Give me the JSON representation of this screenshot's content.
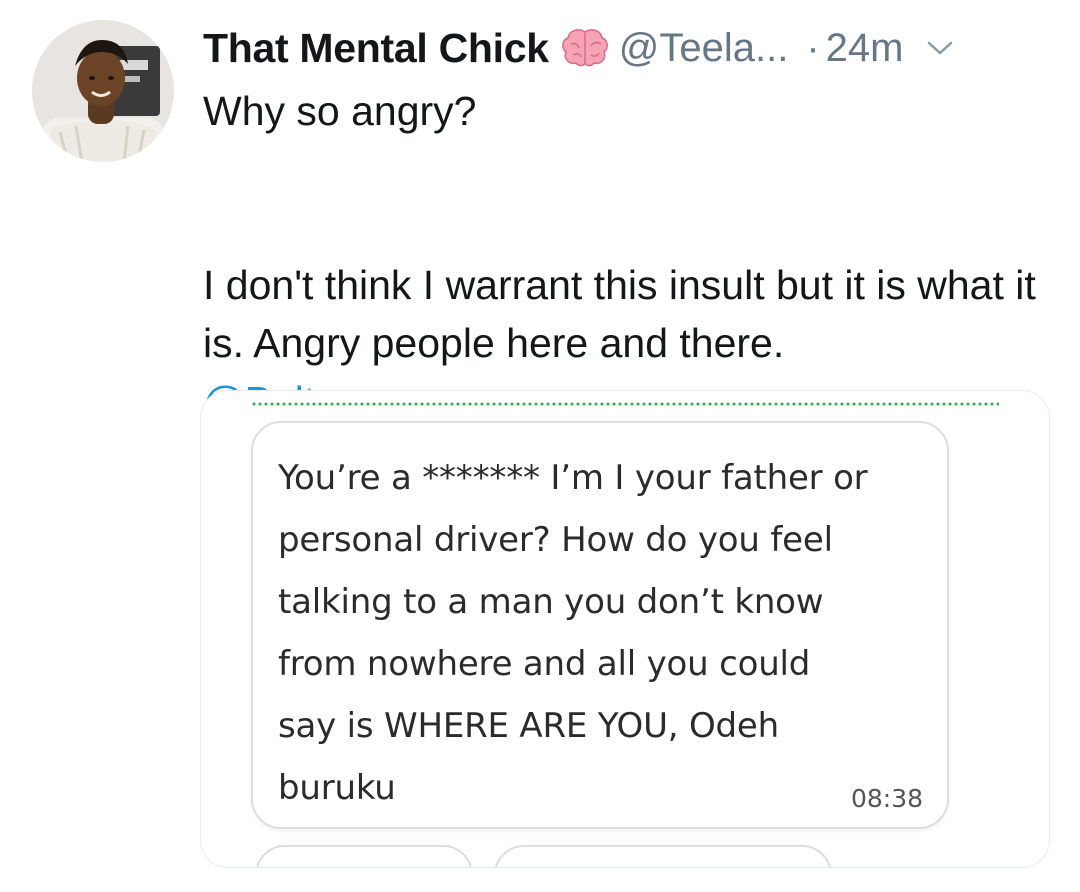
{
  "tweet": {
    "author": {
      "display_name": "That Mental Chick",
      "name_emoji": "brain-icon",
      "handle": "@Teela...",
      "separator": "·",
      "time": "24m"
    },
    "text": {
      "line1": "Why so angry?",
      "line2": "I don't think I warrant this insult but it is what it is. Angry people here and there.",
      "mention": "@Boltapp_ng"
    },
    "media": {
      "message_lines": [
        "You’re a ******* I’m I your father or",
        "personal driver? How do you feel",
        "talking to a man you don’t know",
        "from nowhere and all you could",
        "say is WHERE ARE YOU, Odeh",
        "buruku"
      ],
      "message_time": "08:38"
    }
  },
  "colors": {
    "text_primary": "#14171a",
    "text_secondary": "#657786",
    "link": "#1b95e0",
    "dotted_accent": "#35b04a",
    "card_border": "#e6ecf0"
  }
}
